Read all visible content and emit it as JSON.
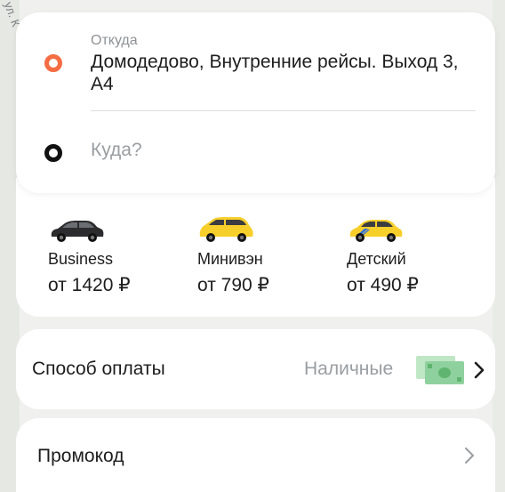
{
  "map": {
    "street_label": "ул. К"
  },
  "route": {
    "from_caption": "Откуда",
    "from_address": "Домодедово, Внутренние рейсы. Выход 3, А4",
    "to_placeholder": "Куда?"
  },
  "tariffs": [
    {
      "name": "Business",
      "price": "от 1420 ₽",
      "car_color": "dark",
      "icon": "business-car-icon"
    },
    {
      "name": "Минивэн",
      "price": "от 790 ₽",
      "car_color": "yellow",
      "icon": "minivan-car-icon"
    },
    {
      "name": "Детский",
      "price": "от 490 ₽",
      "car_color": "yellow",
      "icon": "child-car-icon"
    }
  ],
  "payment": {
    "label": "Способ оплаты",
    "value": "Наличные",
    "icon": "cash-icon"
  },
  "promo": {
    "label": "Промокод"
  },
  "colors": {
    "from_dot": "#f46d43",
    "to_dot": "#111111",
    "taxi_yellow": "#f7cf2b",
    "cash_green": "#8fd19e"
  }
}
